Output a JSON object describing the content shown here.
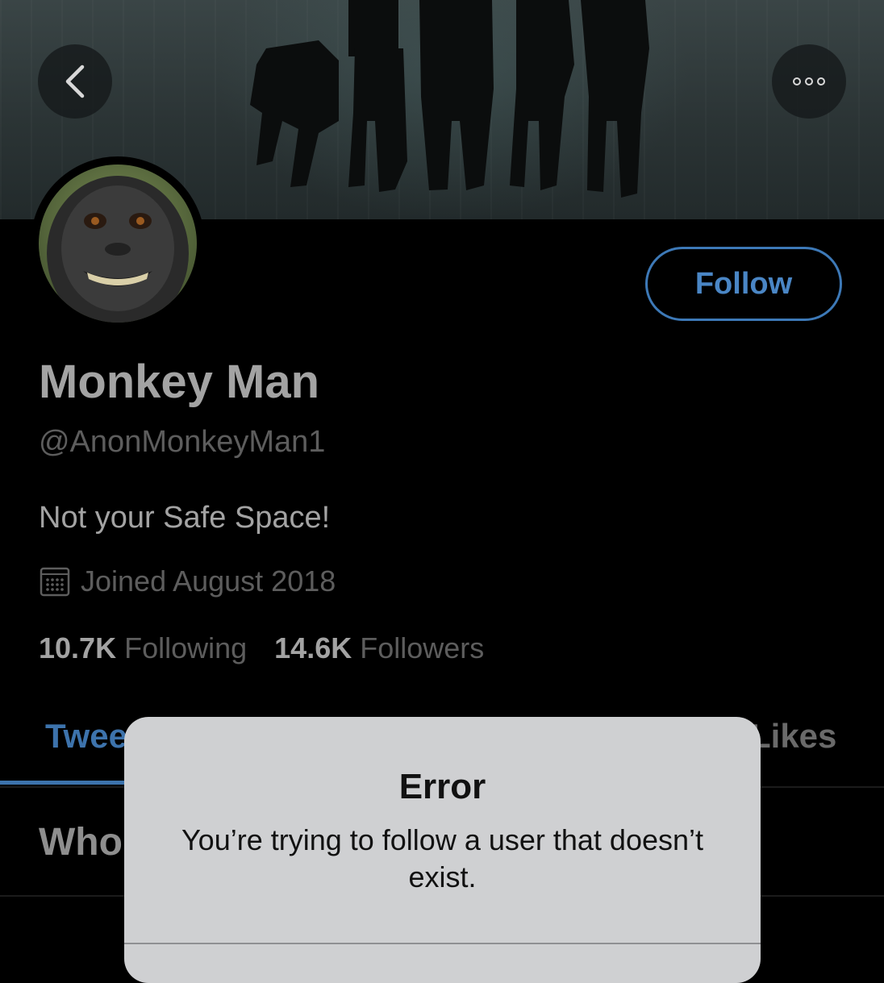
{
  "header": {
    "back_icon": "chevron-left-icon",
    "more_icon": "more-dots-icon"
  },
  "profile": {
    "name": "Monkey Man",
    "handle": "@AnonMonkeyMan1",
    "bio": "Not your Safe Space!",
    "joined": "Joined August 2018",
    "following_count": "10.7K",
    "following_label": "Following",
    "followers_count": "14.6K",
    "followers_label": "Followers",
    "follow_button_label": "Follow"
  },
  "tabs": {
    "active": "Twee",
    "likes": "Likes"
  },
  "section": {
    "heading": "Who"
  },
  "alert": {
    "title": "Error",
    "message": "You’re trying to follow a user that doesn’t exist."
  },
  "colors": {
    "accent": "#3d79b7",
    "background": "#000000",
    "alert_background": "#cfd0d2"
  }
}
